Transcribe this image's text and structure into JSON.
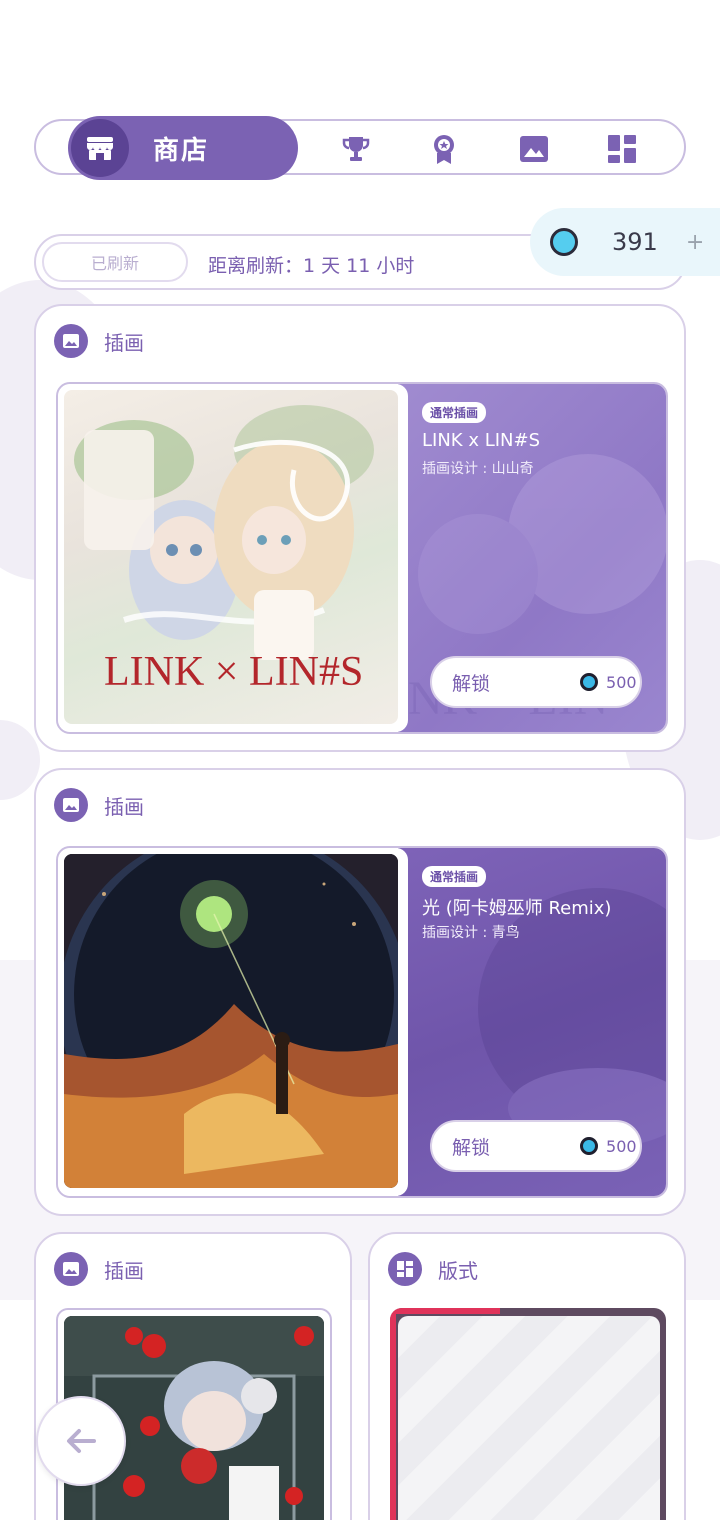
{
  "nav": {
    "active_label": "商店",
    "tabs": [
      {
        "name": "shop",
        "icon": "store-icon"
      },
      {
        "name": "achievements",
        "icon": "trophy-icon"
      },
      {
        "name": "badges",
        "icon": "medal-icon"
      },
      {
        "name": "illustrations",
        "icon": "image-icon"
      },
      {
        "name": "layouts",
        "icon": "dashboard-icon"
      }
    ]
  },
  "refresh": {
    "status": "已刷新",
    "countdown": "距离刷新：1 天 11 小时"
  },
  "currency": {
    "amount": "391",
    "plus": "+"
  },
  "cards": [
    {
      "category": "插画",
      "badge": "通常插画",
      "title": "LINK x LIN#S",
      "designer": "插画设计 : 山山奇",
      "unlock_label": "解锁",
      "price": "500",
      "art_text": "LINK × LIN#S"
    },
    {
      "category": "插画",
      "badge": "通常插画",
      "title": "光 (阿卡姆巫师 Remix)",
      "designer": "插画设计 : 青鸟",
      "unlock_label": "解锁",
      "price": "500"
    }
  ],
  "small_cards": [
    {
      "category": "插画"
    },
    {
      "category": "版式"
    }
  ],
  "colors": {
    "accent": "#7b62b3",
    "accent_dark": "#5b4394",
    "currency_bg": "#e9f6fb",
    "coin": "#55cdef"
  }
}
